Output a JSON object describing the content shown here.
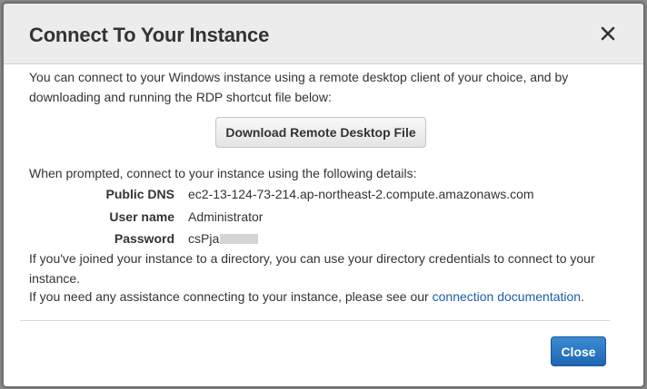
{
  "dialog": {
    "title": "Connect To Your Instance",
    "close_icon": "close-x-icon"
  },
  "intro_text": "You can connect to your Windows instance using a remote desktop client of your choice, and by downloading and running the RDP shortcut file below:",
  "download_button_label": "Download Remote Desktop File",
  "prompt_text": "When prompted, connect to your instance using the following details:",
  "details": {
    "public_dns_label": "Public DNS",
    "public_dns_value": "ec2-13-124-73-214.ap-northeast-2.compute.amazonaws.com",
    "user_name_label": "User name",
    "user_name_value": "Administrator",
    "password_label": "Password",
    "password_value": "csPja"
  },
  "directory_text": "If you've joined your instance to a directory, you can use your directory credentials to connect to your instance.",
  "assistance": {
    "text_before": "If you need any assistance connecting to your instance, please see our ",
    "link_text": "connection documentation",
    "text_after": "."
  },
  "footer": {
    "close_button_label": "Close"
  },
  "colors": {
    "header_bg": "#ececec",
    "primary_button": "#2a78c6",
    "link": "#1a5ea6"
  }
}
